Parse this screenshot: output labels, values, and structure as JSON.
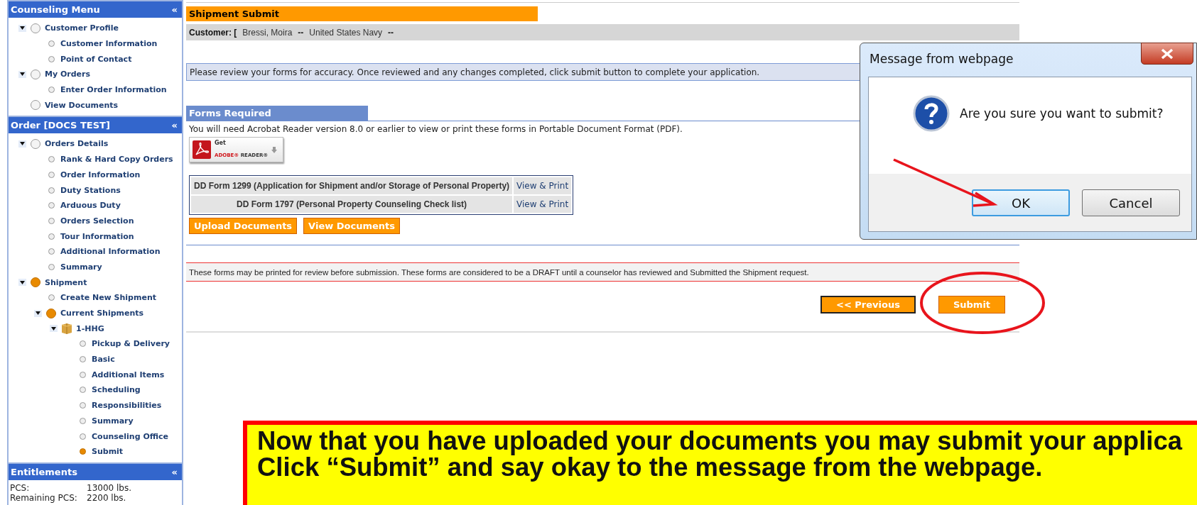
{
  "sidebar": {
    "sections": [
      {
        "title": "Counseling Menu",
        "collapse_glyph": "«",
        "items": [
          {
            "label": "Customer Profile",
            "kind": "group",
            "current": false,
            "expanded": true,
            "children": [
              {
                "label": "Customer Information",
                "kind": "page",
                "current": false
              },
              {
                "label": "Point of Contact",
                "kind": "page",
                "current": false
              }
            ]
          },
          {
            "label": "My Orders",
            "kind": "group",
            "current": false,
            "expanded": true,
            "children": [
              {
                "label": "Enter Order Information",
                "kind": "page",
                "current": false
              }
            ]
          },
          {
            "label": "View Documents",
            "kind": "group",
            "current": false
          }
        ]
      },
      {
        "title": "Order [DOCS TEST]",
        "collapse_glyph": "«",
        "items": [
          {
            "label": "Orders Details",
            "kind": "group",
            "current": false,
            "expanded": true,
            "children": [
              {
                "label": "Rank & Hard Copy Orders",
                "kind": "page",
                "current": false
              },
              {
                "label": "Order Information",
                "kind": "page",
                "current": false
              },
              {
                "label": "Duty Stations",
                "kind": "page",
                "current": false
              },
              {
                "label": "Arduous Duty",
                "kind": "page",
                "current": false
              },
              {
                "label": "Orders Selection",
                "kind": "page",
                "current": false
              },
              {
                "label": "Tour Information",
                "kind": "page",
                "current": false
              },
              {
                "label": "Additional Information",
                "kind": "page",
                "current": false
              },
              {
                "label": "Summary",
                "kind": "page",
                "current": false
              }
            ]
          },
          {
            "label": "Shipment",
            "kind": "group",
            "current": true,
            "expanded": true,
            "children": [
              {
                "label": "Create New Shipment",
                "kind": "page",
                "current": false
              },
              {
                "label": "Current Shipments",
                "kind": "group",
                "current": true,
                "expanded": true,
                "children": [
                  {
                    "label": "1-HHG",
                    "kind": "package",
                    "current": true,
                    "expanded": true,
                    "children": [
                      {
                        "label": "Pickup & Delivery",
                        "kind": "page",
                        "current": false
                      },
                      {
                        "label": "Basic",
                        "kind": "page",
                        "current": false
                      },
                      {
                        "label": "Additional Items",
                        "kind": "page",
                        "current": false
                      },
                      {
                        "label": "Scheduling",
                        "kind": "page",
                        "current": false
                      },
                      {
                        "label": "Responsibilities",
                        "kind": "page",
                        "current": false
                      },
                      {
                        "label": "Summary",
                        "kind": "page",
                        "current": false
                      },
                      {
                        "label": "Counseling Office",
                        "kind": "page",
                        "current": false
                      },
                      {
                        "label": "Submit",
                        "kind": "page",
                        "current": true
                      }
                    ]
                  }
                ]
              }
            ]
          }
        ]
      },
      {
        "title": "Entitlements",
        "collapse_glyph": "«",
        "rows": [
          {
            "label": "PCS:",
            "value": "13000 lbs."
          },
          {
            "label": "Remaining PCS:",
            "value": "2200 lbs."
          }
        ]
      }
    ]
  },
  "page": {
    "title": "Shipment Submit",
    "customer": {
      "label": "Customer: [",
      "name": "Bressi, Moira",
      "separator_1": "--",
      "branch": "United States Navy",
      "separator_2": "--"
    },
    "instruction": "Please review your forms for accuracy. Once reviewed and any changes completed, click submit button to complete your application.",
    "forms": {
      "title": "Forms Required",
      "note": "You will need Acrobat Reader version 8.0 or earlier to view or print these forms in Portable Document Format (PDF).",
      "adobe_badge": {
        "line_1": "Get",
        "brand": "ADOBE®",
        "product": "READER®"
      },
      "rows": [
        {
          "form": "DD Form 1299 (Application for Shipment and/or Storage of Personal Property)",
          "action": "View & Print"
        },
        {
          "form": "DD Form 1797 (Personal Property Counseling Check list)",
          "action": "View & Print"
        }
      ],
      "buttons": [
        "Upload Documents",
        "View Documents"
      ]
    },
    "disclaimer": "These forms may be printed for review before submission. These forms are considered to be a DRAFT until a counselor has reviewed and Submitted the Shipment request.",
    "nav_buttons": [
      "<< Previous",
      "Submit"
    ]
  },
  "dialog": {
    "title": "Message from webpage",
    "message": "Are you sure you want to submit?",
    "buttons": [
      {
        "label": "OK",
        "focused": true
      },
      {
        "label": "Cancel",
        "focused": false
      }
    ]
  },
  "callout": {
    "lines": [
      "Now that you have uploaded your documents you may submit your applica",
      "Click “Submit” and say okay to the message from the webpage."
    ]
  }
}
